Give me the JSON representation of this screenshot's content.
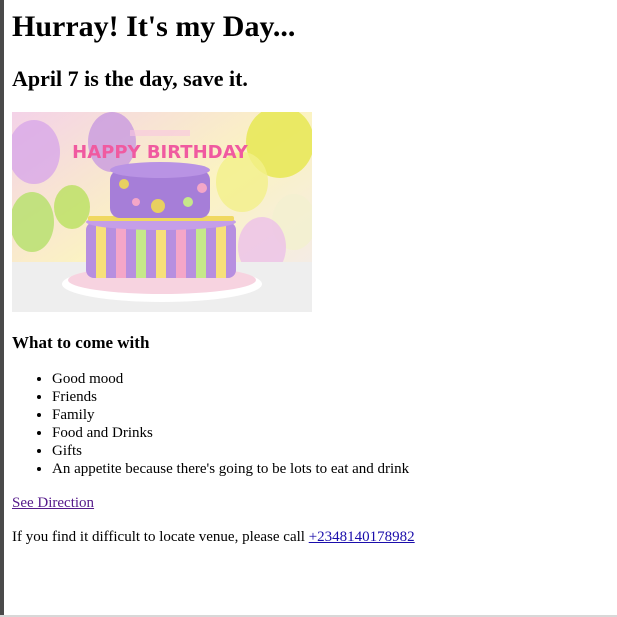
{
  "page": {
    "title": "Hurray! It's my Day...",
    "subtitle": "April 7 is the day, save it."
  },
  "image": {
    "alt": "Happy Birthday cake",
    "cake_text": "HAPPY BIRTHDAY"
  },
  "list_section": {
    "heading": "What to come with",
    "items": [
      "Good mood",
      "Friends",
      "Family",
      "Food and Drinks",
      "Gifts",
      "An appetite because there's going to be lots to eat and drink"
    ]
  },
  "directions": {
    "link_text": "See Direction"
  },
  "contact": {
    "prefix": "If you find it difficult to locate venue, please call ",
    "phone": "+2348140178982"
  },
  "colors": {
    "link": "#1a0dab",
    "visited_link": "#551a8b"
  }
}
